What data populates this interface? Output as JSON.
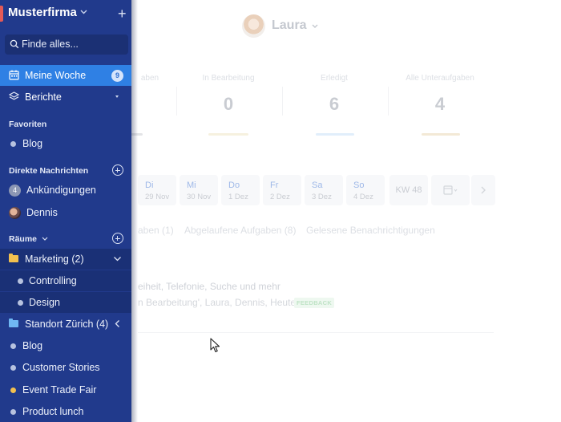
{
  "brand": {
    "name": "Musterfirma"
  },
  "search": {
    "placeholder": "Finde alles..."
  },
  "nav": [
    {
      "label": "Meine Woche",
      "badge": "9",
      "icon": "calendar-icon"
    },
    {
      "label": "Berichte",
      "icon": "layers-icon"
    }
  ],
  "sections": {
    "favorites": "Favoriten",
    "direct_messages": "Direkte Nachrichten",
    "rooms": "Räume"
  },
  "favorites": [
    {
      "label": "Blog"
    }
  ],
  "direct_messages": [
    {
      "label": "Ankündigungen",
      "avatar": "4"
    },
    {
      "label": "Dennis"
    }
  ],
  "rooms": [
    {
      "label": "Marketing (2)",
      "folder_color": "#f2c04f"
    },
    {
      "label": "Controlling",
      "sub": true
    },
    {
      "label": "Design",
      "sub": true
    },
    {
      "label": "Standort Zürich (4)",
      "folder_color": "#6fb7f2"
    },
    {
      "label": "Blog"
    },
    {
      "label": "Customer Stories"
    },
    {
      "label": "Event Trade Fair",
      "dot_color": "#f2c04f"
    },
    {
      "label": "Product lunch"
    }
  ],
  "main": {
    "user": "Laura",
    "stats": [
      {
        "label": "aben",
        "value": ""
      },
      {
        "label": "In Bearbeitung",
        "value": "0"
      },
      {
        "label": "Erledigt",
        "value": "6"
      },
      {
        "label": "Alle Unteraufgaben",
        "value": "4"
      }
    ],
    "days": [
      {
        "d": "Di",
        "date": "29 Nov"
      },
      {
        "d": "Mi",
        "date": "30 Nov"
      },
      {
        "d": "Do",
        "date": "1 Dez"
      },
      {
        "d": "Fr",
        "date": "2 Dez"
      },
      {
        "d": "Sa",
        "date": "3 Dez"
      },
      {
        "d": "So",
        "date": "4 Dez"
      }
    ],
    "week": "KW 48",
    "tabs": [
      "aben (1)",
      "Abgelaufene Aufgaben (8)",
      "Gelesene Benachrichtigungen"
    ],
    "task_title": "eiheit, Telefonie, Suche und mehr",
    "task_meta": "n Bearbeitung', Laura, Dennis, Heute",
    "task_tag": "FEEDBACK"
  },
  "colors": {
    "sidebar": "#213a8c",
    "active": "#2f80e4",
    "brand_accent": "#e45a57"
  }
}
